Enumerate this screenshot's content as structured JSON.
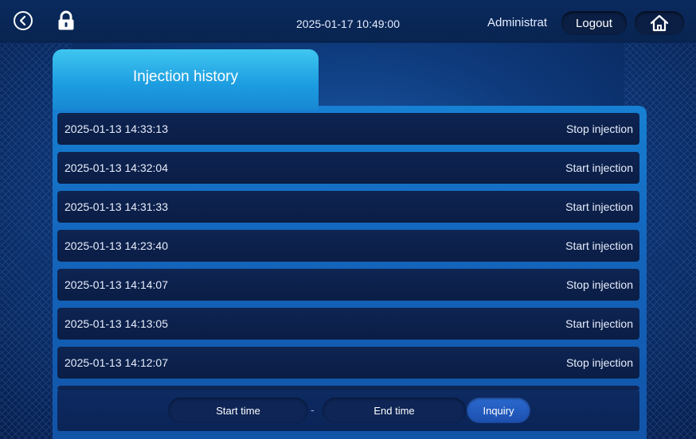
{
  "header": {
    "datetime": "2025-01-17 10:49:00",
    "user": "Administrat",
    "logout_label": "Logout",
    "icons": [
      "back-icon",
      "lock-icon",
      "home-icon"
    ]
  },
  "tab": {
    "title": "Injection history"
  },
  "history": [
    {
      "time": "2025-01-13 14:33:13",
      "event": "Stop injection"
    },
    {
      "time": "2025-01-13 14:32:04",
      "event": "Start injection"
    },
    {
      "time": "2025-01-13 14:31:33",
      "event": "Start injection"
    },
    {
      "time": "2025-01-13 14:23:40",
      "event": "Start injection"
    },
    {
      "time": "2025-01-13 14:14:07",
      "event": "Stop injection"
    },
    {
      "time": "2025-01-13 14:13:05",
      "event": "Start injection"
    },
    {
      "time": "2025-01-13 14:12:07",
      "event": "Stop injection"
    },
    {
      "time": "",
      "event": ""
    }
  ],
  "footer": {
    "start_time_label": "Start time",
    "separator": "-",
    "end_time_label": "End time",
    "inquiry_label": "Inquiry"
  },
  "colors": {
    "background": "#0e3a7c",
    "tab": "#1c9ce0",
    "row": "#0e2452",
    "inquiry": "#2b6ad0"
  }
}
